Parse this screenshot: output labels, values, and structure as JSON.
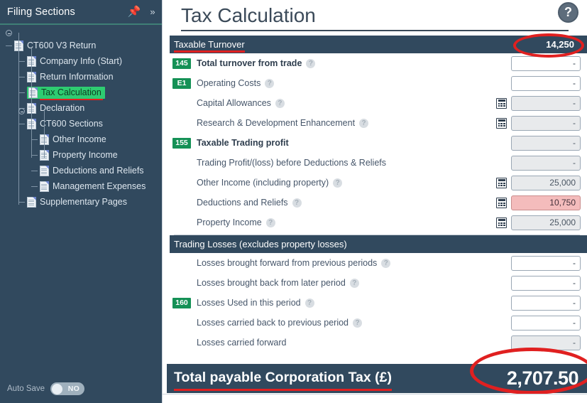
{
  "sidebar": {
    "title": "Filing Sections",
    "pin_icon": "pin-icon",
    "collapse_label": "»",
    "tree": [
      {
        "label": "CT600 V3 Return",
        "depth": 0,
        "selected": false
      },
      {
        "label": "Company Info (Start)",
        "depth": 1,
        "selected": false
      },
      {
        "label": "Return Information",
        "depth": 1,
        "selected": false
      },
      {
        "label": "Tax Calculation",
        "depth": 1,
        "selected": true
      },
      {
        "label": "Declaration",
        "depth": 1,
        "selected": false
      },
      {
        "label": "CT600 Sections",
        "depth": 1,
        "selected": false
      },
      {
        "label": "Other Income",
        "depth": 2,
        "selected": false
      },
      {
        "label": "Property Income",
        "depth": 2,
        "selected": false
      },
      {
        "label": "Deductions and Reliefs",
        "depth": 2,
        "selected": false
      },
      {
        "label": "Management Expenses",
        "depth": 2,
        "selected": false
      },
      {
        "label": "Supplementary Pages",
        "depth": 1,
        "selected": false
      }
    ],
    "autosave": {
      "label": "Auto Save",
      "state": "NO"
    }
  },
  "main": {
    "page_title": "Tax Calculation",
    "help_glyph": "?",
    "sections": [
      {
        "title": "Taxable Turnover",
        "value": "14,250",
        "highlighted": true,
        "rows": [
          {
            "badge": "145",
            "label": "Total turnover from trade",
            "help": true,
            "bold": true,
            "calc": false,
            "value": "-",
            "style": "editable"
          },
          {
            "badge": "E1",
            "label": "Operating Costs",
            "help": true,
            "bold": false,
            "calc": false,
            "value": "-",
            "style": "editable"
          },
          {
            "badge": "",
            "label": "Capital Allowances",
            "help": true,
            "bold": false,
            "calc": true,
            "value": "-",
            "style": "readonly"
          },
          {
            "badge": "",
            "label": "Research & Development Enhancement",
            "help": true,
            "bold": false,
            "calc": true,
            "value": "-",
            "style": "readonly"
          },
          {
            "badge": "155",
            "label": "Taxable Trading profit",
            "help": false,
            "bold": true,
            "calc": false,
            "value": "-",
            "style": "readonly"
          },
          {
            "badge": "",
            "label": "Trading Profit/(loss) before Deductions & Reliefs",
            "help": false,
            "bold": false,
            "calc": false,
            "value": "-",
            "style": "readonly"
          },
          {
            "badge": "",
            "label": "Other Income (including property)",
            "help": true,
            "bold": false,
            "calc": true,
            "value": "25,000",
            "style": "readonly"
          },
          {
            "badge": "",
            "label": "Deductions and Reliefs",
            "help": true,
            "bold": false,
            "calc": true,
            "value": "10,750",
            "style": "alert"
          },
          {
            "badge": "",
            "label": "Property Income",
            "help": true,
            "bold": false,
            "calc": true,
            "value": "25,000",
            "style": "readonly"
          }
        ]
      },
      {
        "title": "Trading Losses (excludes property losses)",
        "value": "",
        "highlighted": false,
        "rows": [
          {
            "badge": "",
            "label": "Losses brought forward from previous periods",
            "help": true,
            "bold": false,
            "calc": false,
            "value": "-",
            "style": "editable"
          },
          {
            "badge": "",
            "label": "Losses brought back from later period",
            "help": true,
            "bold": false,
            "calc": false,
            "value": "-",
            "style": "editable"
          },
          {
            "badge": "160",
            "label": "Losses Used in this period",
            "help": true,
            "bold": false,
            "calc": false,
            "value": "-",
            "style": "editable"
          },
          {
            "badge": "",
            "label": "Losses carried back to previous period",
            "help": true,
            "bold": false,
            "calc": false,
            "value": "-",
            "style": "editable"
          },
          {
            "badge": "",
            "label": "Losses carried forward",
            "help": false,
            "bold": false,
            "calc": false,
            "value": "-",
            "style": "readonly"
          }
        ]
      }
    ],
    "total": {
      "label": "Total payable Corporation Tax (£)",
      "value": "2,707.50"
    }
  },
  "colors": {
    "navy": "#31495e",
    "green_badge": "#159156",
    "annotation_red": "#e02020",
    "selection_green": "#2ecc71",
    "alert_pink": "#f4bcbc"
  }
}
